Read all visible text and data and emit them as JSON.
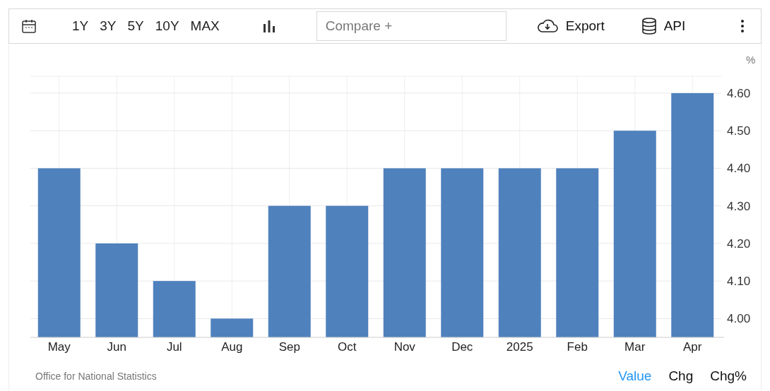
{
  "toolbar": {
    "ranges": [
      {
        "label": "1Y"
      },
      {
        "label": "3Y"
      },
      {
        "label": "5Y"
      },
      {
        "label": "10Y"
      },
      {
        "label": "MAX"
      }
    ],
    "compare": {
      "placeholder": "Compare +"
    },
    "export": "Export",
    "api": "API"
  },
  "chart": {
    "unit": "%",
    "chart_data": {
      "type": "bar",
      "categories": [
        "May",
        "Jun",
        "Jul",
        "Aug",
        "Sep",
        "Oct",
        "Nov",
        "Dec",
        "2025",
        "Feb",
        "Mar",
        "Apr"
      ],
      "grid": true,
      "series": [
        {
          "color": "#4f81bd",
          "values": [
            4.4,
            4.2,
            4.1,
            4.0,
            4.3,
            4.3,
            4.4,
            4.4,
            4.4,
            4.4,
            4.5,
            4.6
          ]
        }
      ],
      "ylim": [
        3.95,
        4.645
      ],
      "yticks": [
        {
          "value": 4.0,
          "label": "4.00"
        },
        {
          "value": 4.1,
          "label": "4.10"
        },
        {
          "value": 4.2,
          "label": "4.20"
        },
        {
          "value": 4.3,
          "label": "4.30"
        },
        {
          "value": 4.4,
          "label": "4.40"
        },
        {
          "value": 4.5,
          "label": "4.50"
        },
        {
          "value": 4.6,
          "label": "4.60"
        }
      ]
    }
  },
  "footer": {
    "source": "Office for National Statistics",
    "views": [
      {
        "label": "Value",
        "selected": true
      },
      {
        "label": "Chg",
        "selected": false
      },
      {
        "label": "Chg%",
        "selected": false
      }
    ]
  }
}
